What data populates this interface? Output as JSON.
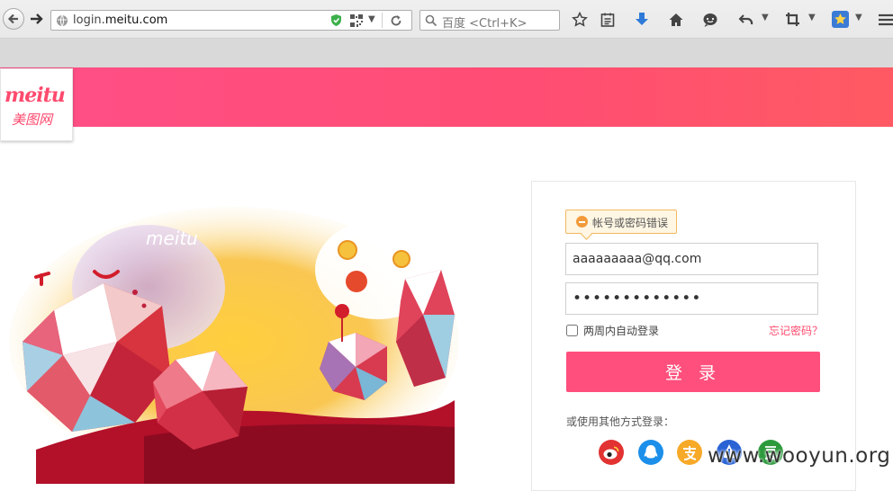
{
  "browser": {
    "url_prefix": "login.",
    "url_domain": "meitu.com",
    "search_placeholder": "百度 <Ctrl+K>",
    "toolbar_icons": [
      "back-icon",
      "forward-icon",
      "globe-icon",
      "shield-icon",
      "qr-code-icon",
      "reload-icon",
      "search-icon",
      "bookmark-star-icon",
      "reader-icon",
      "download-icon",
      "home-icon",
      "chat-icon",
      "undo-icon",
      "crop-icon",
      "addon-star-icon",
      "menu-icon"
    ]
  },
  "header": {
    "logo_en": "meitu",
    "logo_cn": "美图网",
    "brand_color": "#ff4f7c"
  },
  "illustration": {
    "label": "meitu"
  },
  "login": {
    "error_message": "帐号或密码错误",
    "account_value": "aaaaaaaaa@qq.com",
    "password_value": "aaaaaaaaaaaaa",
    "remember_label": "两周内自动登录",
    "remember_checked": false,
    "forgot_link": "忘记密码？",
    "submit_label": "登 录",
    "other_methods_label": "或使用其他方式登录：",
    "social_icons": [
      "weibo-icon",
      "qq-icon",
      "alipay-icon",
      "baidu-icon",
      "douban-icon"
    ]
  },
  "watermark": "www.wooyun.org"
}
